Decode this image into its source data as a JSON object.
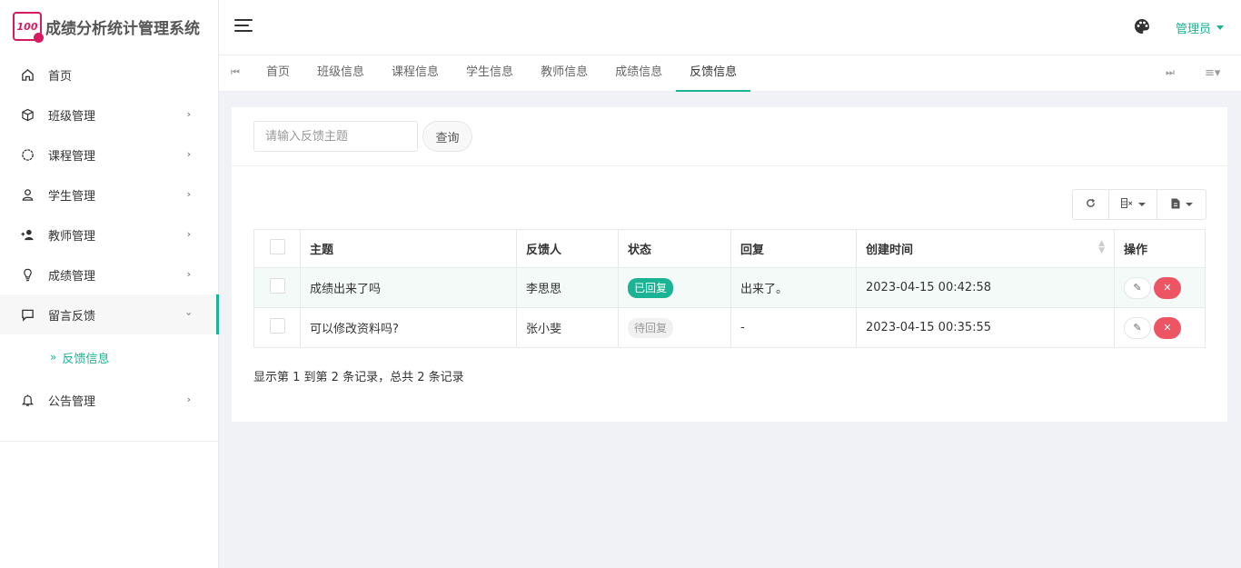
{
  "brand": {
    "logo_text": "100",
    "title": "成绩分析统计管理系统"
  },
  "sidebar": {
    "items": [
      {
        "label": "首页",
        "icon": "home-icon",
        "has_arrow": false
      },
      {
        "label": "班级管理",
        "icon": "cube-icon",
        "has_arrow": true
      },
      {
        "label": "课程管理",
        "icon": "circle-icon",
        "has_arrow": true
      },
      {
        "label": "学生管理",
        "icon": "user-icon",
        "has_arrow": true
      },
      {
        "label": "教师管理",
        "icon": "user-plus-icon",
        "has_arrow": true
      },
      {
        "label": "成绩管理",
        "icon": "bulb-icon",
        "has_arrow": true
      },
      {
        "label": "留言反馈",
        "icon": "comment-icon",
        "has_arrow": true,
        "expanded": true
      },
      {
        "label": "公告管理",
        "icon": "bell-icon",
        "has_arrow": true
      }
    ],
    "submenu": {
      "label": "反馈信息",
      "chevron": "»"
    }
  },
  "header": {
    "user_label": "管理员"
  },
  "tabs": [
    "首页",
    "班级信息",
    "课程信息",
    "学生信息",
    "教师信息",
    "成绩信息",
    "反馈信息"
  ],
  "active_tab": "反馈信息",
  "search": {
    "placeholder": "请输入反馈主题",
    "button_label": "查询"
  },
  "table": {
    "headers": [
      "主题",
      "反馈人",
      "状态",
      "回复",
      "创建时间",
      "操作"
    ],
    "rows": [
      {
        "subject": "成绩出来了吗",
        "user": "李思思",
        "status": "已回复",
        "status_type": "done",
        "reply": "出来了。",
        "created": "2023-04-15 00:42:58"
      },
      {
        "subject": "可以修改资料吗?",
        "user": "张小斐",
        "status": "待回复",
        "status_type": "wait",
        "reply": "-",
        "created": "2023-04-15 00:35:55"
      }
    ]
  },
  "pager": {
    "info": "显示第 1 到第 2 条记录，总共 2 条记录"
  },
  "colors": {
    "accent": "#1ab394",
    "danger": "#ed5565",
    "brand": "#d81b60"
  }
}
